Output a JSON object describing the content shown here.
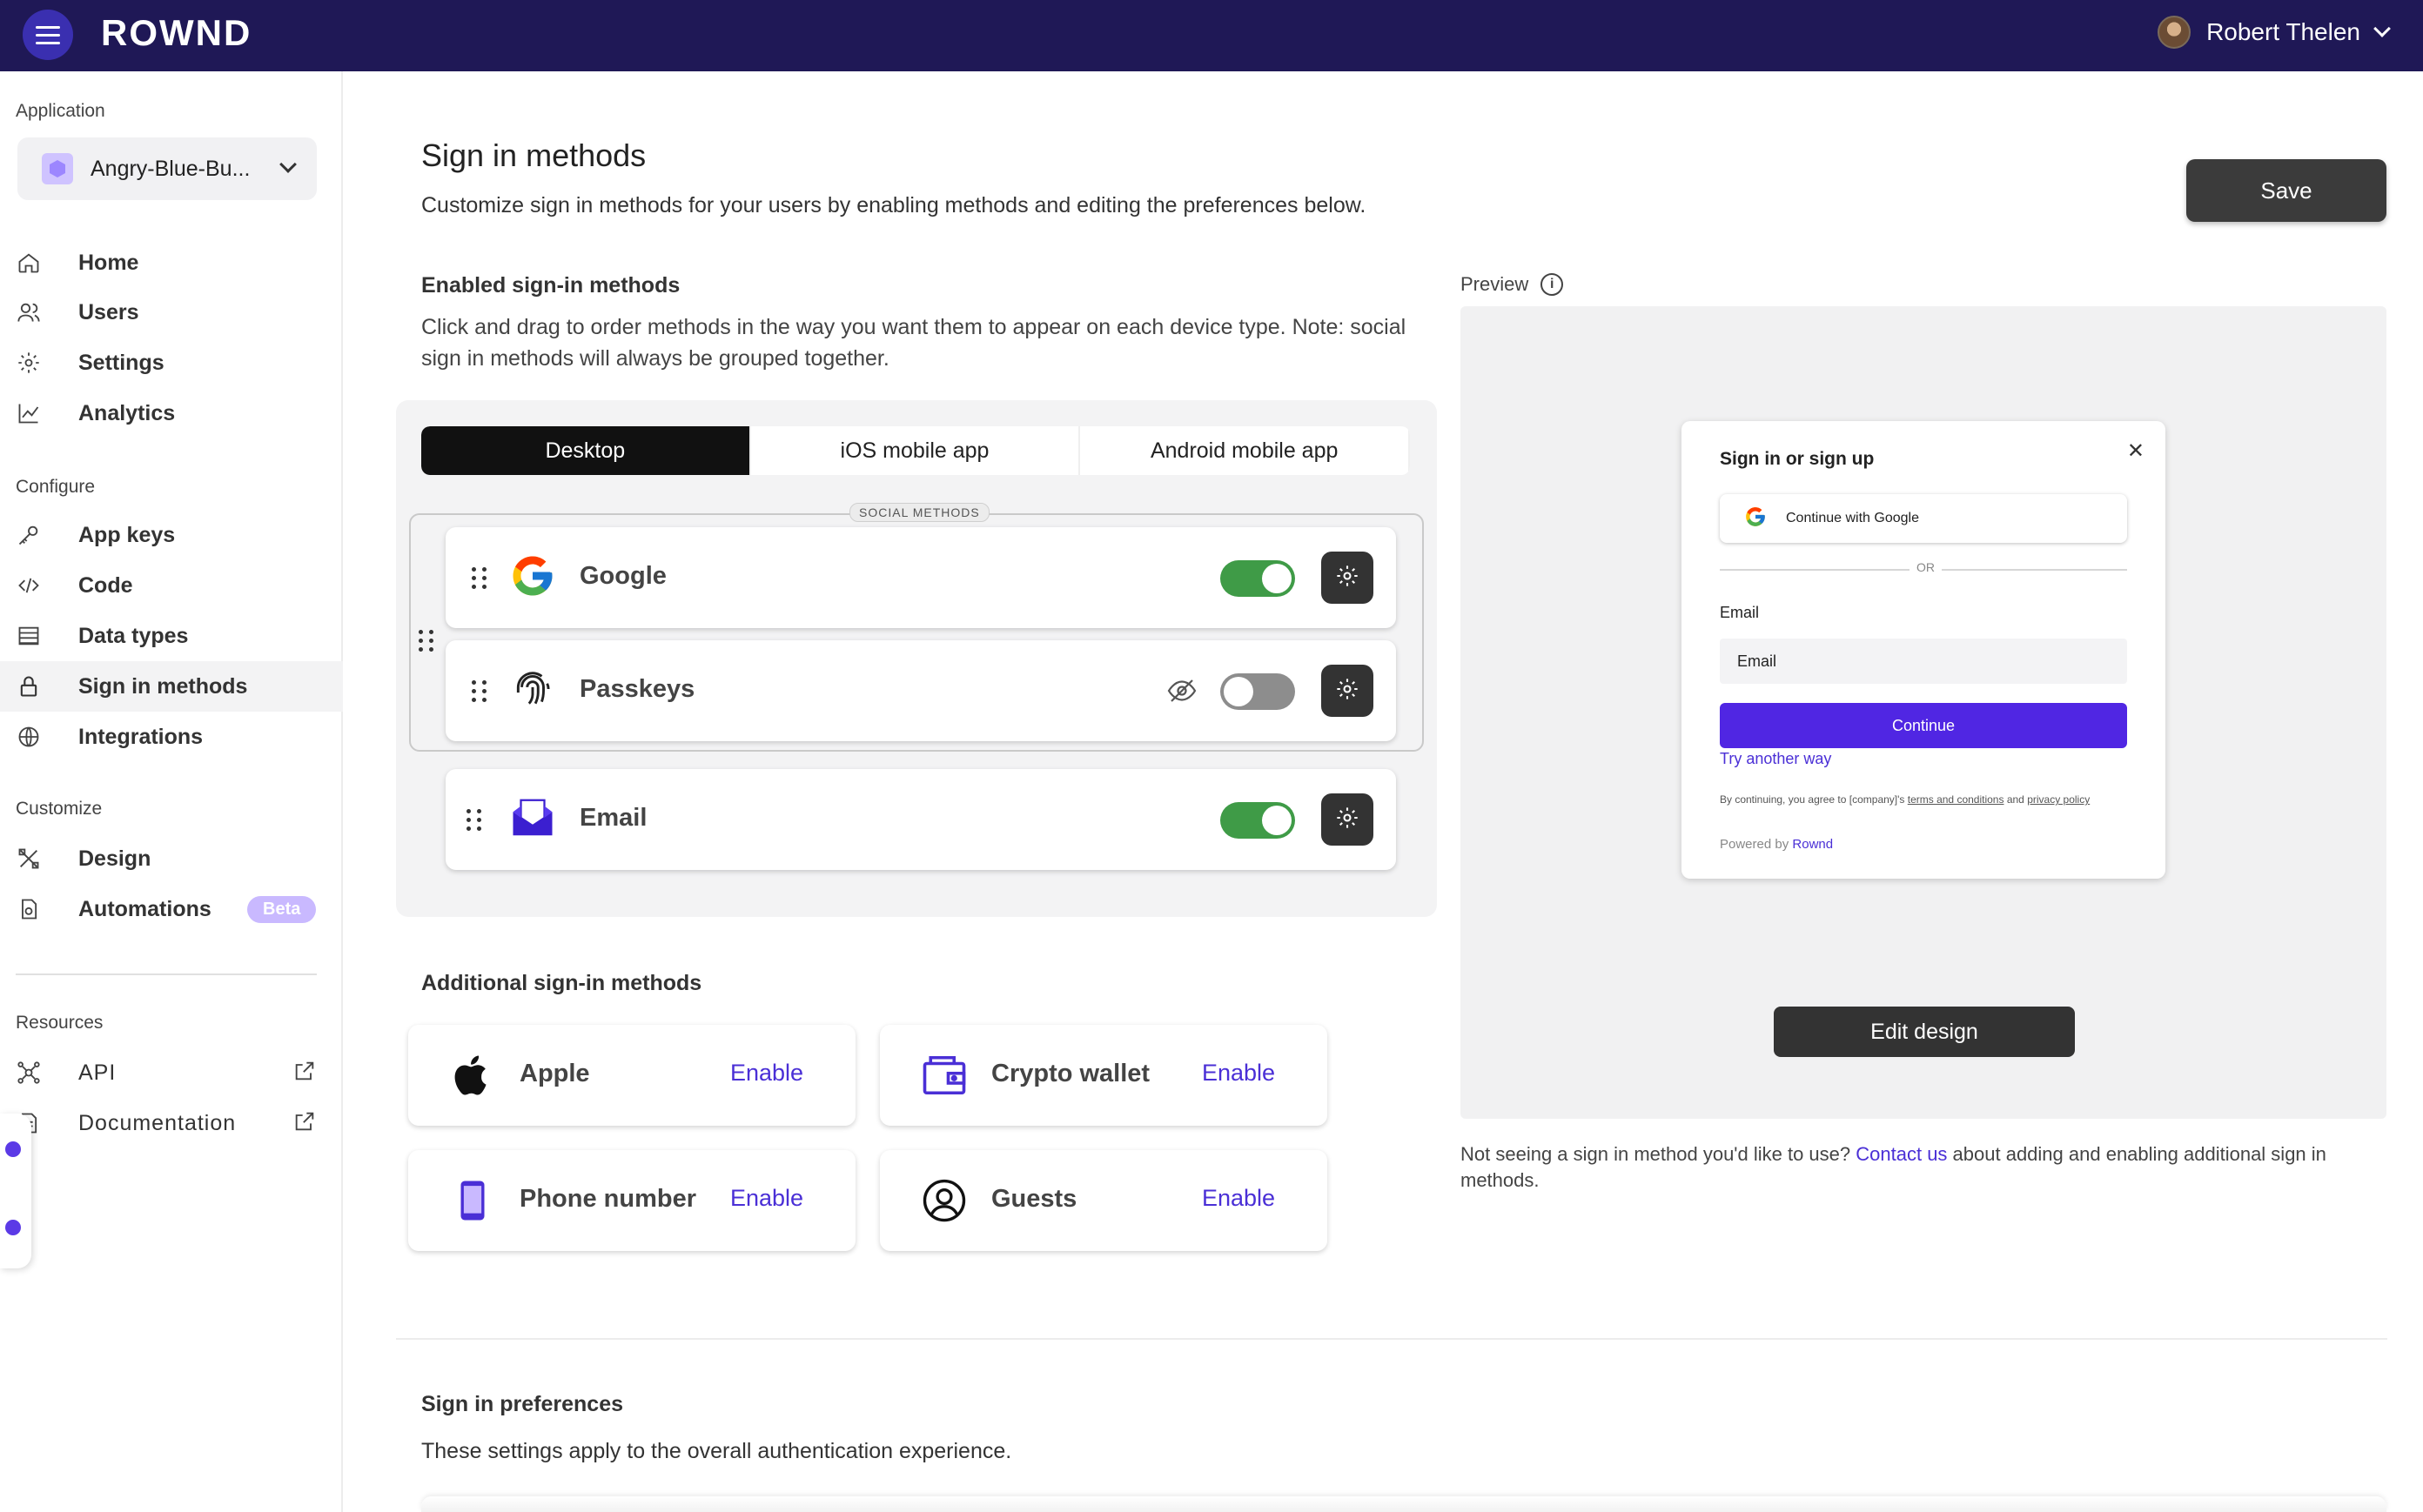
{
  "topbar": {
    "brand": "ROWND",
    "user_name": "Robert Thelen"
  },
  "sidebar": {
    "application_label": "Application",
    "app_name": "Angry-Blue-Bu...",
    "main_items": [
      {
        "label": "Home",
        "icon": "home-icon"
      },
      {
        "label": "Users",
        "icon": "users-icon"
      },
      {
        "label": "Settings",
        "icon": "gear-icon"
      },
      {
        "label": "Analytics",
        "icon": "analytics-icon"
      }
    ],
    "configure_label": "Configure",
    "configure_items": [
      {
        "label": "App keys",
        "icon": "key-icon"
      },
      {
        "label": "Code",
        "icon": "code-icon"
      },
      {
        "label": "Data types",
        "icon": "table-icon"
      },
      {
        "label": "Sign in methods",
        "icon": "lock-icon",
        "active": true
      },
      {
        "label": "Integrations",
        "icon": "integrations-icon"
      }
    ],
    "customize_label": "Customize",
    "customize_items": [
      {
        "label": "Design",
        "icon": "design-icon"
      },
      {
        "label": "Automations",
        "icon": "automations-icon",
        "badge": "Beta"
      }
    ],
    "resources_label": "Resources",
    "resources_items": [
      {
        "label": "API",
        "icon": "api-icon"
      },
      {
        "label": "Documentation",
        "icon": "document-icon"
      }
    ]
  },
  "main": {
    "title": "Sign in methods",
    "subtitle": "Customize sign in methods for your users by enabling methods and editing the preferences below.",
    "save_label": "Save",
    "enabled_title": "Enabled sign-in methods",
    "enabled_desc_line1": "Click and drag to order methods in the way you want them to appear on each device type. Note: social",
    "enabled_desc_line2": "sign in methods will always be grouped together.",
    "tabs": [
      "Desktop",
      "iOS mobile app",
      "Android mobile app"
    ],
    "active_tab": "Desktop",
    "social_group_label": "SOCIAL METHODS",
    "methods": [
      {
        "name": "Google",
        "enabled": true
      },
      {
        "name": "Passkeys",
        "enabled": false,
        "hidden": true
      },
      {
        "name": "Email",
        "enabled": true
      }
    ],
    "additional_title": "Additional sign-in methods",
    "additional": [
      {
        "name": "Apple",
        "action": "Enable"
      },
      {
        "name": "Crypto wallet",
        "action": "Enable"
      },
      {
        "name": "Phone number",
        "action": "Enable"
      },
      {
        "name": "Guests",
        "action": "Enable"
      }
    ],
    "preferences_title": "Sign in preferences",
    "preferences_desc": "These settings apply to the overall authentication experience."
  },
  "preview": {
    "label": "Preview",
    "modal_title": "Sign in or sign up",
    "google_button": "Continue with Google",
    "or_text": "OR",
    "email_label": "Email",
    "email_placeholder": "Email",
    "continue_label": "Continue",
    "try_another": "Try another way",
    "legal_prefix": "By continuing, you agree to [company]'s ",
    "legal_terms": "terms and conditions",
    "legal_and": " and ",
    "legal_privacy": "privacy policy",
    "powered_prefix": "Powered by ",
    "powered_brand": "Rownd",
    "edit_design": "Edit design",
    "note_prefix": "Not seeing a sign in method you'd like to use? ",
    "note_link": "Contact us",
    "note_suffix": " about adding and enabling additional sign in methods."
  },
  "colors": {
    "topbar": "#1f1856",
    "accent": "#4a2fd6",
    "toggle_on": "#3f9b47",
    "toggle_off": "#8d8d8d"
  }
}
